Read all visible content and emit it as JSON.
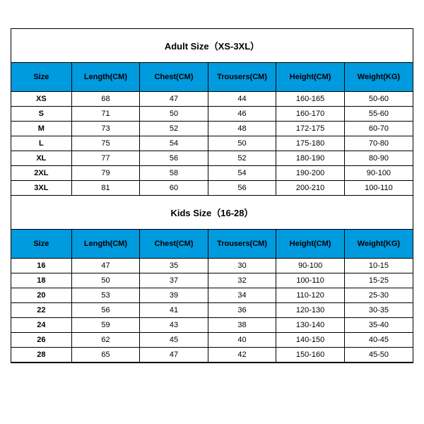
{
  "adult": {
    "title": "Adult Size（XS-3XL）",
    "headers": [
      "Size",
      "Length(CM)",
      "Chest(CM)",
      "Trousers(CM)",
      "Height(CM)",
      "Weight(KG)"
    ],
    "rows": [
      [
        "XS",
        "68",
        "47",
        "44",
        "160-165",
        "50-60"
      ],
      [
        "S",
        "71",
        "50",
        "46",
        "160-170",
        "55-60"
      ],
      [
        "M",
        "73",
        "52",
        "48",
        "172-175",
        "60-70"
      ],
      [
        "L",
        "75",
        "54",
        "50",
        "175-180",
        "70-80"
      ],
      [
        "XL",
        "77",
        "56",
        "52",
        "180-190",
        "80-90"
      ],
      [
        "2XL",
        "79",
        "58",
        "54",
        "190-200",
        "90-100"
      ],
      [
        "3XL",
        "81",
        "60",
        "56",
        "200-210",
        "100-110"
      ]
    ]
  },
  "kids": {
    "title": "Kids Size（16-28）",
    "headers": [
      "Size",
      "Length(CM)",
      "Chest(CM)",
      "Trousers(CM)",
      "Height(CM)",
      "Weight(KG)"
    ],
    "rows": [
      [
        "16",
        "47",
        "35",
        "30",
        "90-100",
        "10-15"
      ],
      [
        "18",
        "50",
        "37",
        "32",
        "100-110",
        "15-25"
      ],
      [
        "20",
        "53",
        "39",
        "34",
        "110-120",
        "25-30"
      ],
      [
        "22",
        "56",
        "41",
        "36",
        "120-130",
        "30-35"
      ],
      [
        "24",
        "59",
        "43",
        "38",
        "130-140",
        "35-40"
      ],
      [
        "26",
        "62",
        "45",
        "40",
        "140-150",
        "40-45"
      ],
      [
        "28",
        "65",
        "47",
        "42",
        "150-160",
        "45-50"
      ]
    ]
  }
}
